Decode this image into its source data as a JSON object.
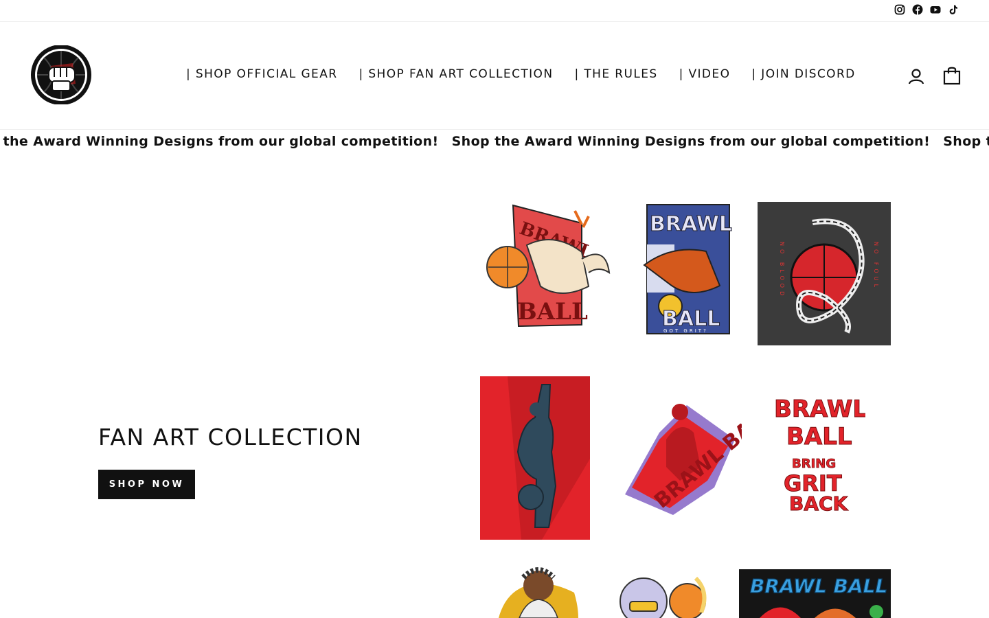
{
  "social": {
    "icons": [
      "instagram-icon",
      "facebook-icon",
      "youtube-icon",
      "tiktok-icon"
    ]
  },
  "header": {
    "logo_icon": "fist-basketball-logo",
    "nav": [
      "| SHOP OFFICIAL GEAR",
      "| SHOP FAN ART COLLECTION",
      "| THE RULES",
      "| VIDEO",
      "| JOIN DISCORD"
    ],
    "account_icon": "user-icon",
    "cart_icon": "bag-icon"
  },
  "announcement": {
    "text": "Shop the Award Winning Designs from our global competition!"
  },
  "hero": {
    "title": "FAN ART COLLECTION",
    "button_label": "SHOP NOW"
  },
  "gallery": {
    "images": [
      "brawl-ball-dog-art",
      "brawl-ball-tiger-art",
      "no-blood-no-foul-snake-art",
      "red-player-dunk-art",
      "brawl-ball-jumper-art",
      "brawl-ball-bring-grit-back-art",
      "player-portrait-art",
      "cartoon-ball-character-art",
      "brawl-ball-graffiti-art"
    ],
    "texts": {
      "dog_brawl": "BRAWL",
      "dog_ball": "BALL",
      "tiger_brawl": "BRAWL",
      "tiger_ball": "BALL",
      "tiger_grit": "GOT GRIT?",
      "snake_left": "NO BLOOD",
      "snake_right": "NO FOUL",
      "jumper": "BRAWL BALL",
      "grit_brawl": "BRAWL",
      "grit_ball": "BALL",
      "grit_bring": "BRING",
      "grit_grit": "GRIT",
      "grit_back": "BACK",
      "graffiti": "BRAWL BALL"
    }
  },
  "colors": {
    "text": "#111111",
    "button_bg": "#111111",
    "accent_red": "#e5201f"
  }
}
